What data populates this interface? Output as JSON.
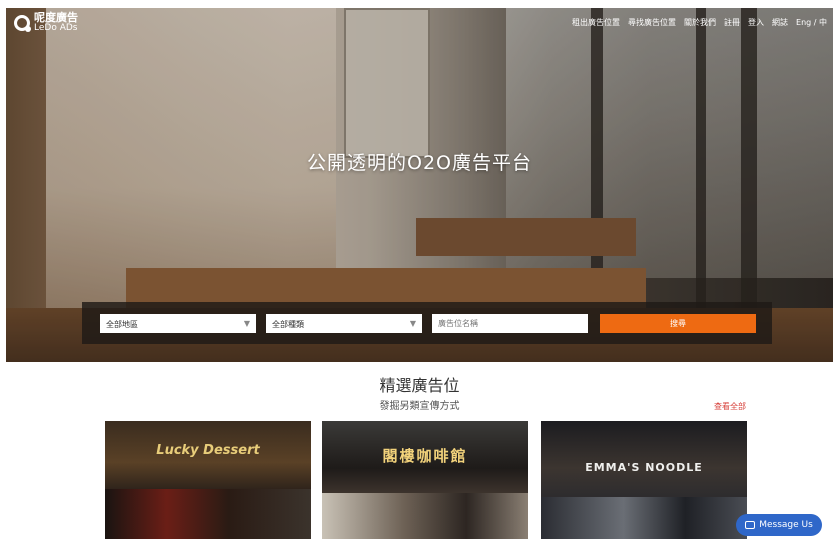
{
  "brand": {
    "name_cn": "呢度廣告",
    "name_en": "LeDo ADs"
  },
  "nav": [
    "租出廣告位置",
    "尋找廣告位置",
    "關於我們",
    "註冊",
    "登入",
    "網誌",
    "Eng / 中"
  ],
  "hero": {
    "title": "公開透明的O2O廣告平台"
  },
  "search": {
    "district_value": "全部地區",
    "category_value": "全部種類",
    "name_placeholder": "廣告位名稱",
    "button_label": "搜尋"
  },
  "featured": {
    "title": "精選廣告位",
    "subtitle": "發掘另類宣傳方式",
    "view_all": "查看全部",
    "cards": [
      {
        "name": "",
        "sign_text": "Lucky Dessert"
      },
      {
        "name": "",
        "sign_text": "閣樓咖啡館"
      },
      {
        "name": "",
        "sign_text": "EMMA'S NOODLE"
      }
    ]
  },
  "chat": {
    "label": "Message Us"
  },
  "colors": {
    "accent": "#ee6a12",
    "link": "#d7403a",
    "chat": "#2f67c9"
  }
}
